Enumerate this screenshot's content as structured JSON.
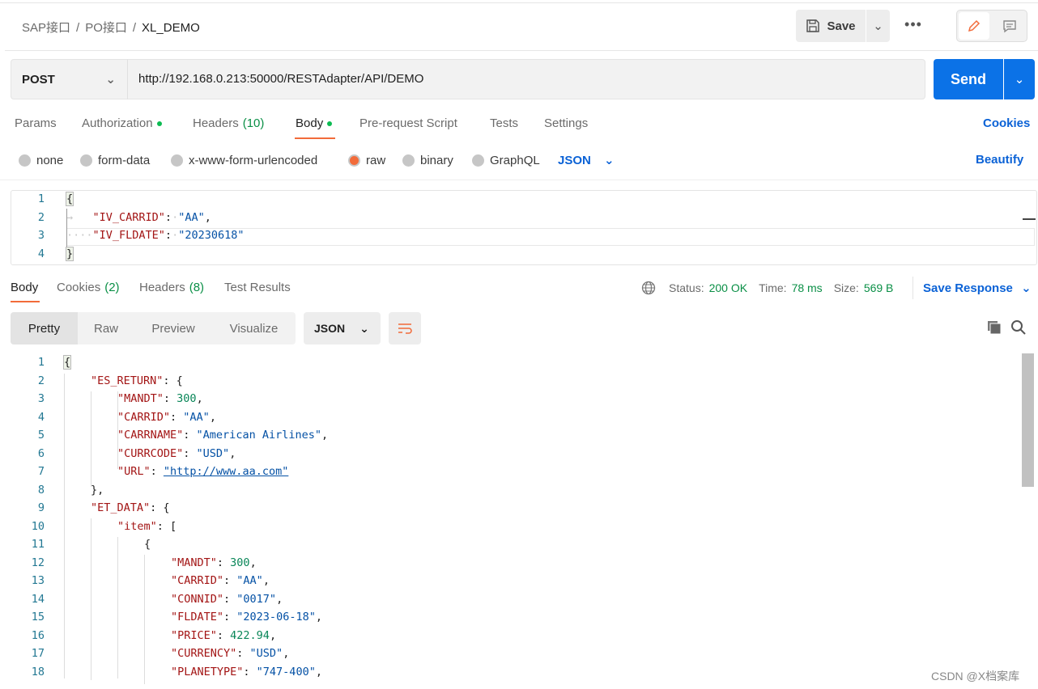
{
  "breadcrumb": {
    "items": [
      "SAP接口",
      "PO接口"
    ],
    "current": "XL_DEMO",
    "separator": "/"
  },
  "toolbar": {
    "save_label": "Save",
    "more_label": "•••"
  },
  "request": {
    "method": "POST",
    "url": "http://192.168.0.213:50000/RESTAdapter/API/DEMO",
    "send_label": "Send"
  },
  "tabs": [
    {
      "label": "Params"
    },
    {
      "label": "Authorization",
      "dot": true
    },
    {
      "label": "Headers",
      "count": "(10)"
    },
    {
      "label": "Body",
      "dot": true,
      "active": true
    },
    {
      "label": "Pre-request Script"
    },
    {
      "label": "Tests"
    },
    {
      "label": "Settings"
    }
  ],
  "cookies_label": "Cookies",
  "body_types": [
    {
      "label": "none"
    },
    {
      "label": "form-data"
    },
    {
      "label": "x-www-form-urlencoded"
    },
    {
      "label": "raw",
      "selected": true
    },
    {
      "label": "binary"
    },
    {
      "label": "GraphQL"
    }
  ],
  "raw_format": "JSON",
  "beautify_label": "Beautify",
  "request_body": [
    {
      "n": "1",
      "text": "{"
    },
    {
      "n": "2",
      "key": "\"IV_CARRID\"",
      "val": "\"AA\"",
      "vtype": "s",
      "tail": ","
    },
    {
      "n": "3",
      "key": "\"IV_FLDATE\"",
      "val": "\"20230618\"",
      "vtype": "s",
      "tail": ""
    },
    {
      "n": "4",
      "text": "}"
    }
  ],
  "response": {
    "tabs": [
      {
        "label": "Body",
        "active": true
      },
      {
        "label": "Cookies",
        "count": "(2)"
      },
      {
        "label": "Headers",
        "count": "(8)"
      },
      {
        "label": "Test Results"
      }
    ],
    "status_label": "Status:",
    "status": "200 OK",
    "time_label": "Time:",
    "time": "78 ms",
    "size_label": "Size:",
    "size": "569 B",
    "save_response_label": "Save Response",
    "views": [
      "Pretty",
      "Raw",
      "Preview",
      "Visualize"
    ],
    "active_view": "Pretty",
    "format": "JSON",
    "lines": [
      {
        "n": "1",
        "i": 0,
        "text": "{"
      },
      {
        "n": "2",
        "i": 1,
        "key": "\"ES_RETURN\"",
        "text": "{"
      },
      {
        "n": "3",
        "i": 2,
        "key": "\"MANDT\"",
        "val": "300",
        "vtype": "n",
        "tail": ","
      },
      {
        "n": "4",
        "i": 2,
        "key": "\"CARRID\"",
        "val": "\"AA\"",
        "vtype": "s",
        "tail": ","
      },
      {
        "n": "5",
        "i": 2,
        "key": "\"CARRNAME\"",
        "val": "\"American Airlines\"",
        "vtype": "s",
        "tail": ","
      },
      {
        "n": "6",
        "i": 2,
        "key": "\"CURRCODE\"",
        "val": "\"USD\"",
        "vtype": "s",
        "tail": ","
      },
      {
        "n": "7",
        "i": 2,
        "key": "\"URL\"",
        "val": "\"http://www.aa.com\"",
        "vtype": "url",
        "tail": ""
      },
      {
        "n": "8",
        "i": 1,
        "text": "},"
      },
      {
        "n": "9",
        "i": 1,
        "key": "\"ET_DATA\"",
        "text": "{"
      },
      {
        "n": "10",
        "i": 2,
        "key": "\"item\"",
        "text": "["
      },
      {
        "n": "11",
        "i": 3,
        "text": "{"
      },
      {
        "n": "12",
        "i": 4,
        "key": "\"MANDT\"",
        "val": "300",
        "vtype": "n",
        "tail": ","
      },
      {
        "n": "13",
        "i": 4,
        "key": "\"CARRID\"",
        "val": "\"AA\"",
        "vtype": "s",
        "tail": ","
      },
      {
        "n": "14",
        "i": 4,
        "key": "\"CONNID\"",
        "val": "\"0017\"",
        "vtype": "s",
        "tail": ","
      },
      {
        "n": "15",
        "i": 4,
        "key": "\"FLDATE\"",
        "val": "\"2023-06-18\"",
        "vtype": "s",
        "tail": ","
      },
      {
        "n": "16",
        "i": 4,
        "key": "\"PRICE\"",
        "val": "422.94",
        "vtype": "n",
        "tail": ","
      },
      {
        "n": "17",
        "i": 4,
        "key": "\"CURRENCY\"",
        "val": "\"USD\"",
        "vtype": "s",
        "tail": ","
      },
      {
        "n": "18",
        "i": 4,
        "key": "\"PLANETYPE\"",
        "val": "\"747-400\"",
        "vtype": "s",
        "tail": ","
      }
    ]
  },
  "watermark": "CSDN @X档案库",
  "colors": {
    "accent": "#f26b3a",
    "send": "#0b72e7",
    "link": "#0b62d6",
    "success": "#0a8f46"
  }
}
